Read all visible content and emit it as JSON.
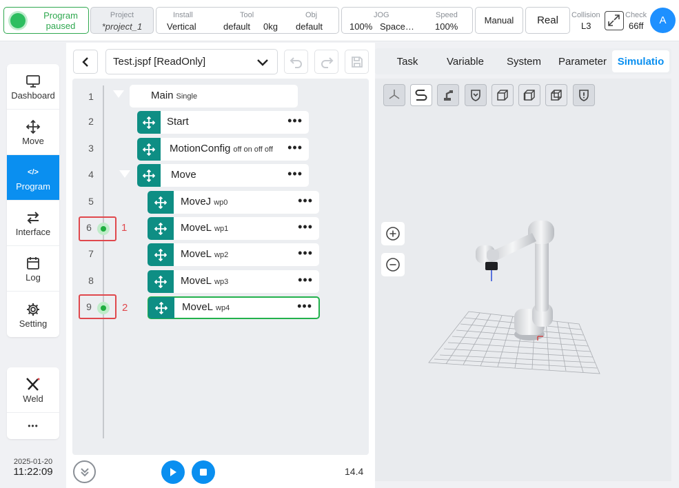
{
  "topbar": {
    "status": {
      "line1": "Program",
      "line2": "paused"
    },
    "project": {
      "label": "Project",
      "value": "*project_1"
    },
    "install": {
      "label": "Install",
      "value": "Vertical"
    },
    "tool": {
      "label": "Tool",
      "value": "default",
      "payload": "0kg"
    },
    "obj": {
      "label": "Obj",
      "value": "default"
    },
    "jog": {
      "label": "JOG",
      "value": "100%",
      "frame": "Space…"
    },
    "speed": {
      "label": "Speed",
      "value": "100%"
    },
    "mode_button": "Manual",
    "env_button": "Real",
    "collision": {
      "label": "Collision",
      "value": "L3"
    },
    "check": {
      "label": "Check",
      "value": "66ff"
    },
    "avatar_letter": "A"
  },
  "nav": {
    "items": [
      {
        "label": "Dashboard",
        "icon": "monitor-icon"
      },
      {
        "label": "Move",
        "icon": "move-arrows-icon"
      },
      {
        "label": "Program",
        "icon": "code-icon",
        "active": true
      },
      {
        "label": "Interface",
        "icon": "swap-arrows-icon"
      },
      {
        "label": "Log",
        "icon": "calendar-icon"
      },
      {
        "label": "Setting",
        "icon": "gear-icon"
      }
    ],
    "extra": [
      {
        "label": "Weld",
        "icon": "weld-torch-icon"
      },
      {
        "label": "•••",
        "icon": "more-icon"
      }
    ],
    "date": "2025-01-20",
    "time": "11:22:09"
  },
  "program": {
    "file": "Test.jspf [ReadOnly]",
    "lines": [
      {
        "num": "1",
        "name": "Main",
        "sub": "Single"
      },
      {
        "num": "2",
        "name": "Start",
        "sub": ""
      },
      {
        "num": "3",
        "name": "MotionConfig",
        "sub": "off on off off"
      },
      {
        "num": "4",
        "name": "Move",
        "sub": ""
      },
      {
        "num": "5",
        "name": "MoveJ",
        "sub": "wp0"
      },
      {
        "num": "6",
        "name": "MoveL",
        "sub": "wp1"
      },
      {
        "num": "7",
        "name": "MoveL",
        "sub": "wp2"
      },
      {
        "num": "8",
        "name": "MoveL",
        "sub": "wp3"
      },
      {
        "num": "9",
        "name": "MoveL",
        "sub": "wp4"
      }
    ],
    "more_glyph": "•••",
    "marker_labels": [
      "1",
      "2"
    ],
    "zoom": "14.4"
  },
  "right_tabs": [
    "Task",
    "Variable",
    "System",
    "Parameter",
    "Simulatio"
  ],
  "colors": {
    "accent": "#0a8ff0",
    "handle": "#0e8e84",
    "running": "#2dbe60",
    "marker": "#e0474c"
  }
}
